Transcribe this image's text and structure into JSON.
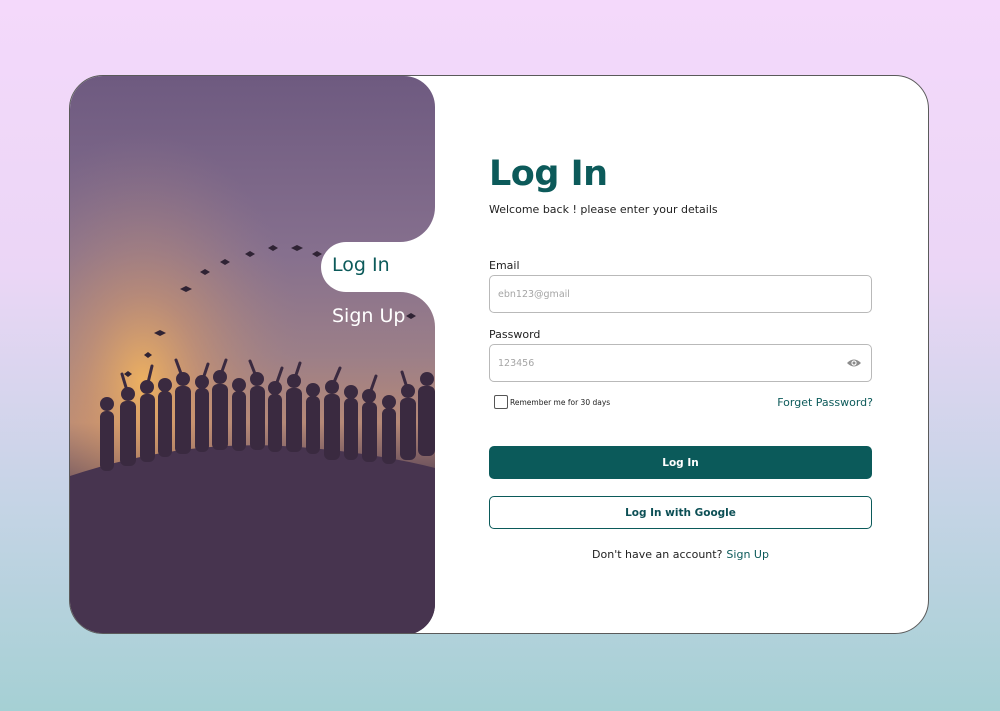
{
  "tabs": {
    "login": "Log In",
    "signup": "Sign Up"
  },
  "form": {
    "title": "Log In",
    "subtitle": "Welcome back ! please enter your details",
    "email_label": "Email",
    "email_placeholder": "ebn123@gmail",
    "password_label": "Password",
    "password_placeholder": "123456",
    "remember_label": "Remember me for 30 days",
    "forgot_label": "Forget Password?",
    "login_button": "Log In",
    "google_button": "Log In with Google",
    "no_account_text": "Don't have an account?",
    "signup_link": "Sign Up"
  },
  "colors": {
    "brand": "#0b5a5a",
    "hero_top": "#6e5a80",
    "hero_bottom": "#45344e",
    "glow": "#e8a560"
  },
  "icons": {
    "password_toggle": "eye-icon"
  }
}
